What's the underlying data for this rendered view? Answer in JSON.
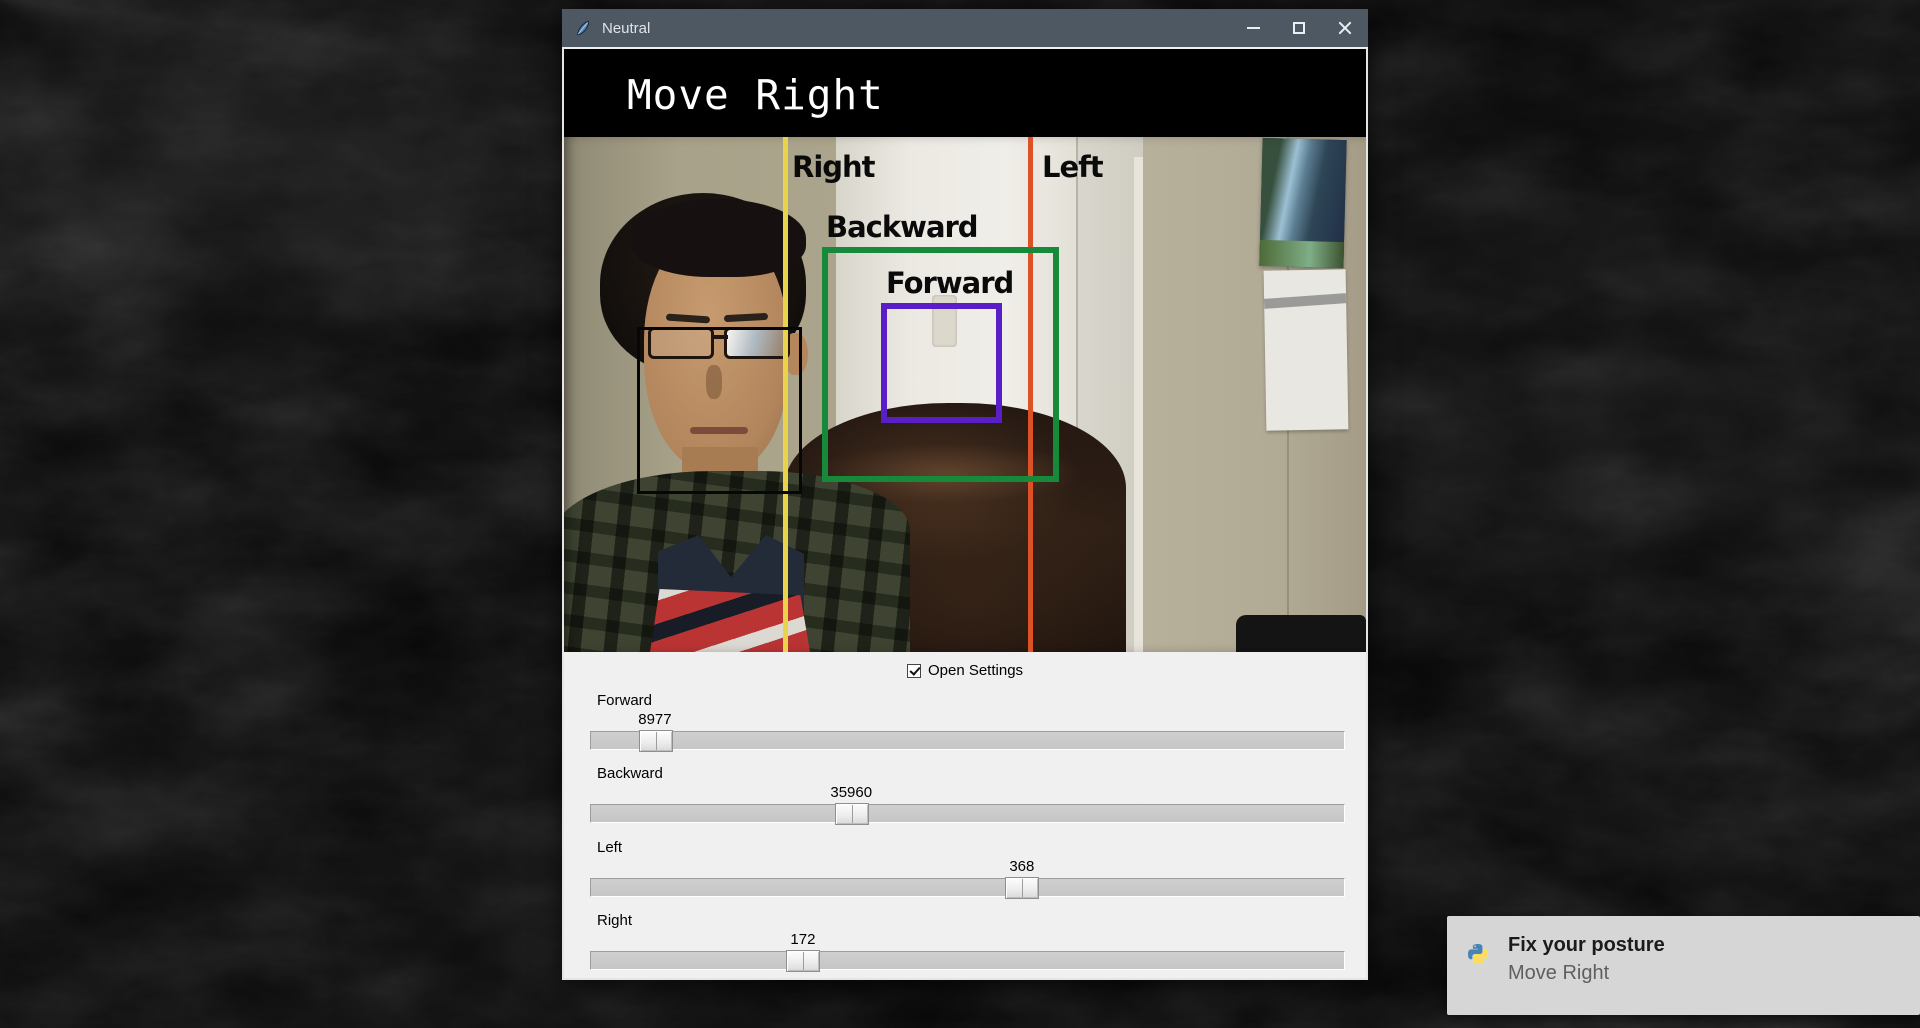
{
  "window": {
    "title": "Neutral",
    "banner_text": "Move Right",
    "camera_overlays": {
      "right_line_label": "Right",
      "left_line_label": "Left",
      "backward_box_label": "Backward",
      "forward_box_label": "Forward"
    },
    "settings": {
      "checkbox_label": "Open Settings",
      "checkbox_checked": true,
      "sliders": [
        {
          "label": "Forward",
          "value": "8977",
          "handle_pct": 8.6
        },
        {
          "label": "Backward",
          "value": "35960",
          "handle_pct": 34.6
        },
        {
          "label": "Left",
          "value": "368",
          "handle_pct": 57.2
        },
        {
          "label": "Right",
          "value": "172",
          "handle_pct": 28.2
        }
      ]
    }
  },
  "notification": {
    "title": "Fix your posture",
    "body": "Move Right"
  },
  "icons": {
    "app": "tk-feather-icon",
    "notification": "python-icon",
    "titlebar": [
      "minimize-icon",
      "maximize-icon",
      "close-icon"
    ]
  },
  "colors": {
    "titlebar": "#4d5863",
    "banner_bg": "#000000",
    "right_line": "#e8d34b",
    "left_line": "#dc5126",
    "backward_box": "#17893b",
    "forward_box": "#5a1ec6",
    "face_box": "#070707",
    "settings_bg": "#f0f0f0",
    "notification_bg": "#d6d6d6"
  }
}
